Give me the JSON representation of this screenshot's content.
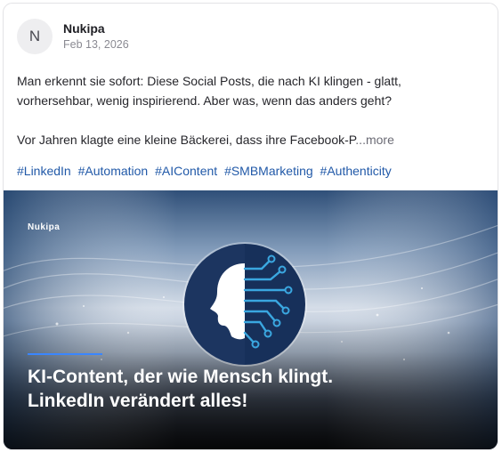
{
  "post": {
    "avatar_initial": "N",
    "author": "Nukipa",
    "date": "Feb 13, 2026",
    "paragraph1": "Man erkennt sie sofort: Diese Social Posts, die nach KI klingen - glatt, vorhersehbar, wenig inspirierend. Aber was, wenn das anders geht?",
    "paragraph2": "Vor Jahren klagte eine kleine Bäckerei, dass ihre Facebook-P",
    "more_label": "...more",
    "hashtags": [
      "#LinkedIn",
      "#Automation",
      "#AIContent",
      "#SMBMarketing",
      "#Authenticity"
    ]
  },
  "image": {
    "brand": "Nukipa",
    "headline_line1": "KI-Content, der wie Mensch klingt.",
    "headline_line2": "LinkedIn verändert alles!",
    "icon": "ai-head-circuit-icon"
  },
  "colors": {
    "hashtag": "#2159a8",
    "accent_line": "#3a86ff",
    "logo_navy": "#1c3560",
    "logo_blue": "#3aa7e0"
  }
}
